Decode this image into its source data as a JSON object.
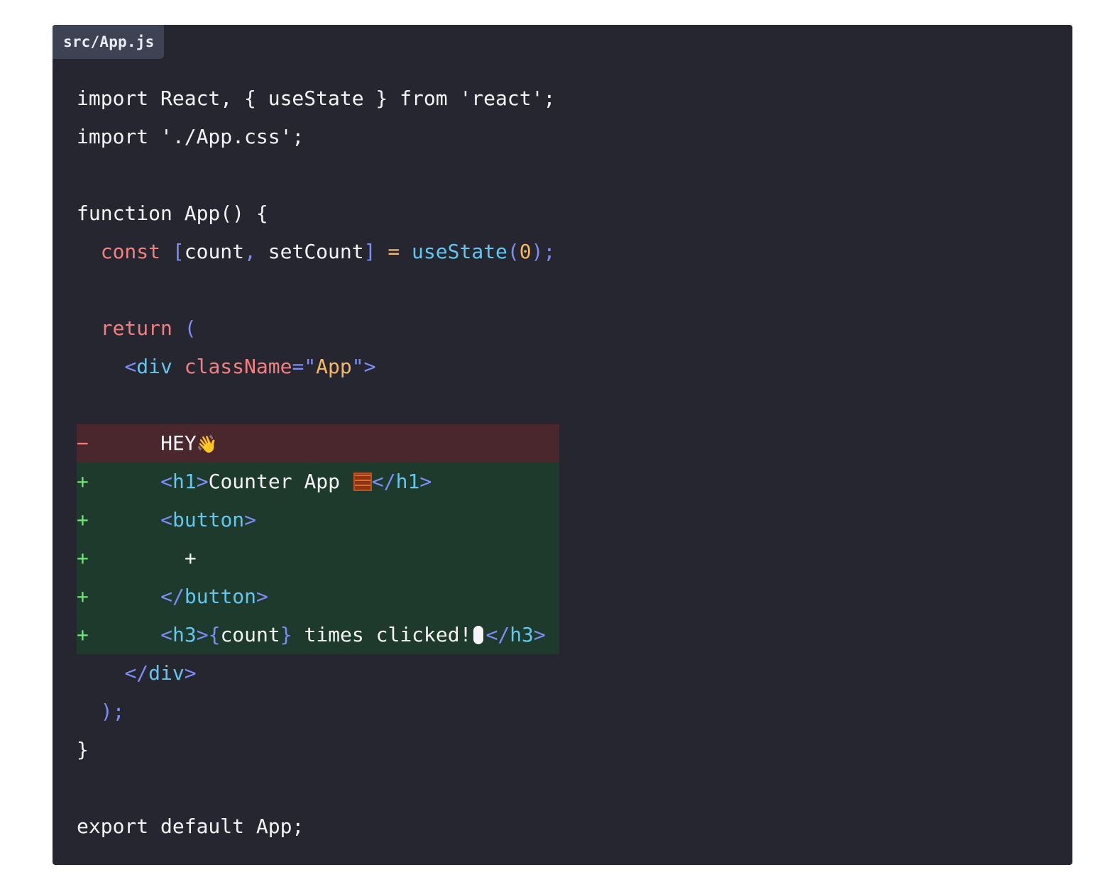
{
  "file_tab": {
    "name": "src/App.js"
  },
  "colors": {
    "background": "#ffffff",
    "code_bg": "#252630",
    "tab_bg": "#3d4353",
    "removed_bg": "#4a272d",
    "added_bg": "#1e3a2c",
    "keyword": "#f47f80",
    "punctuation": "#7d8df6",
    "function": "#62c6ee",
    "string": "#f8b766",
    "plain": "#f4f4f6"
  },
  "lines": [
    {
      "diff": "",
      "tokens": [
        {
          "t": "import React, { useState } from 'react';",
          "c": "plain"
        }
      ]
    },
    {
      "diff": "",
      "tokens": [
        {
          "t": "import './App.css';",
          "c": "plain"
        }
      ]
    },
    {
      "diff": "",
      "tokens": []
    },
    {
      "diff": "",
      "tokens": [
        {
          "t": "function App() {",
          "c": "plain"
        }
      ]
    },
    {
      "diff": "",
      "tokens": [
        {
          "t": "  ",
          "c": "plain"
        },
        {
          "t": "const",
          "c": "kw"
        },
        {
          "t": " ",
          "c": "plain"
        },
        {
          "t": "[",
          "c": "punc"
        },
        {
          "t": "count",
          "c": "plain"
        },
        {
          "t": ",",
          "c": "punc"
        },
        {
          "t": " setCount",
          "c": "plain"
        },
        {
          "t": "]",
          "c": "punc"
        },
        {
          "t": " ",
          "c": "plain"
        },
        {
          "t": "=",
          "c": "op"
        },
        {
          "t": " ",
          "c": "plain"
        },
        {
          "t": "useState",
          "c": "fn"
        },
        {
          "t": "(",
          "c": "punc"
        },
        {
          "t": "0",
          "c": "num"
        },
        {
          "t": ");",
          "c": "punc"
        }
      ]
    },
    {
      "diff": "",
      "tokens": []
    },
    {
      "diff": "",
      "tokens": [
        {
          "t": "  ",
          "c": "plain"
        },
        {
          "t": "return",
          "c": "kw"
        },
        {
          "t": " ",
          "c": "plain"
        },
        {
          "t": "(",
          "c": "punc"
        }
      ]
    },
    {
      "diff": "",
      "tokens": [
        {
          "t": "    ",
          "c": "plain"
        },
        {
          "t": "<",
          "c": "punc"
        },
        {
          "t": "div",
          "c": "tag"
        },
        {
          "t": " ",
          "c": "plain"
        },
        {
          "t": "className",
          "c": "attr"
        },
        {
          "t": "=",
          "c": "punc"
        },
        {
          "t": "\"",
          "c": "punc"
        },
        {
          "t": "App",
          "c": "str"
        },
        {
          "t": "\"",
          "c": "punc"
        },
        {
          "t": ">",
          "c": "punc"
        }
      ]
    },
    {
      "diff": "",
      "tokens": []
    },
    {
      "diff": "removed",
      "mark": "−",
      "tokens": [
        {
          "t": "      HEY",
          "c": "plain"
        },
        {
          "t": "👋",
          "c": "emoji"
        }
      ]
    },
    {
      "diff": "added",
      "mark": "+",
      "tokens": [
        {
          "t": "      ",
          "c": "plain"
        },
        {
          "t": "<",
          "c": "punc"
        },
        {
          "t": "h1",
          "c": "tag"
        },
        {
          "t": ">",
          "c": "punc"
        },
        {
          "t": "Counter App ",
          "c": "plain"
        },
        {
          "t": "",
          "c": "abacus"
        },
        {
          "t": "</",
          "c": "punc"
        },
        {
          "t": "h1",
          "c": "tag"
        },
        {
          "t": ">",
          "c": "punc"
        }
      ]
    },
    {
      "diff": "added",
      "mark": "+",
      "tokens": [
        {
          "t": "      ",
          "c": "plain"
        },
        {
          "t": "<",
          "c": "punc"
        },
        {
          "t": "button",
          "c": "tag"
        },
        {
          "t": ">",
          "c": "punc"
        }
      ]
    },
    {
      "diff": "added",
      "mark": "+",
      "tokens": [
        {
          "t": "        +",
          "c": "plain"
        }
      ]
    },
    {
      "diff": "added",
      "mark": "+",
      "tokens": [
        {
          "t": "      ",
          "c": "plain"
        },
        {
          "t": "</",
          "c": "punc"
        },
        {
          "t": "button",
          "c": "tag"
        },
        {
          "t": ">",
          "c": "punc"
        }
      ]
    },
    {
      "diff": "added",
      "mark": "+",
      "tokens": [
        {
          "t": "      ",
          "c": "plain"
        },
        {
          "t": "<",
          "c": "punc"
        },
        {
          "t": "h3",
          "c": "tag"
        },
        {
          "t": ">",
          "c": "punc"
        },
        {
          "t": "{",
          "c": "punc"
        },
        {
          "t": "count",
          "c": "plain"
        },
        {
          "t": "}",
          "c": "punc"
        },
        {
          "t": " times clicked!",
          "c": "plain"
        },
        {
          "t": "",
          "c": "mouse"
        },
        {
          "t": "</",
          "c": "punc"
        },
        {
          "t": "h3",
          "c": "tag"
        },
        {
          "t": ">",
          "c": "punc"
        }
      ]
    },
    {
      "diff": "",
      "tokens": [
        {
          "t": "    ",
          "c": "plain"
        },
        {
          "t": "</",
          "c": "punc"
        },
        {
          "t": "div",
          "c": "tag"
        },
        {
          "t": ">",
          "c": "punc"
        }
      ]
    },
    {
      "diff": "",
      "tokens": [
        {
          "t": "  ",
          "c": "plain"
        },
        {
          "t": ");",
          "c": "punc"
        }
      ]
    },
    {
      "diff": "",
      "tokens": [
        {
          "t": "}",
          "c": "plain"
        }
      ]
    },
    {
      "diff": "",
      "tokens": []
    },
    {
      "diff": "",
      "tokens": [
        {
          "t": "export default App;",
          "c": "plain"
        }
      ]
    }
  ]
}
